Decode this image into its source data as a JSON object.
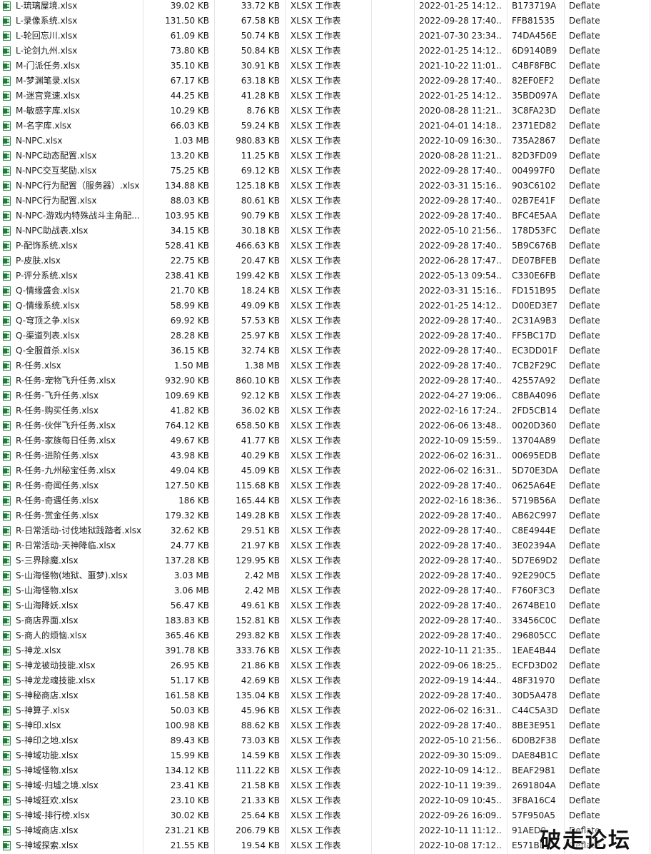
{
  "file_type_label": "XLSX 工作表",
  "method_label": "Deflate",
  "watermark": "破走论坛",
  "icon": "xlsx-file-icon",
  "files": [
    {
      "name": "L-琉璃屋境.xlsx",
      "size": "39.02 KB",
      "packed": "33.72 KB",
      "modified": "2022-01-25 14:12...",
      "crc": "B173719A"
    },
    {
      "name": "L-录像系统.xlsx",
      "size": "131.50 KB",
      "packed": "67.58 KB",
      "modified": "2022-09-28 17:40...",
      "crc": "FFB81535"
    },
    {
      "name": "L-轮回忘川.xlsx",
      "size": "61.09 KB",
      "packed": "50.74 KB",
      "modified": "2021-07-30 23:34...",
      "crc": "74DA456E"
    },
    {
      "name": "L-论剑九州.xlsx",
      "size": "73.80 KB",
      "packed": "50.84 KB",
      "modified": "2022-01-25 14:12...",
      "crc": "6D9140B9"
    },
    {
      "name": "M-门派任务.xlsx",
      "size": "35.10 KB",
      "packed": "30.91 KB",
      "modified": "2021-10-22 11:01...",
      "crc": "C4BF8FBC"
    },
    {
      "name": "M-梦渊笔录.xlsx",
      "size": "67.17 KB",
      "packed": "63.18 KB",
      "modified": "2022-09-28 17:40...",
      "crc": "82EF0EF2"
    },
    {
      "name": "M-迷宫竞速.xlsx",
      "size": "44.25 KB",
      "packed": "41.28 KB",
      "modified": "2022-01-25 14:12...",
      "crc": "35BD097A"
    },
    {
      "name": "M-敏感字库.xlsx",
      "size": "10.29 KB",
      "packed": "8.76 KB",
      "modified": "2020-08-28 11:21...",
      "crc": "3C8FA23D"
    },
    {
      "name": "M-名字库.xlsx",
      "size": "66.03 KB",
      "packed": "59.24 KB",
      "modified": "2021-04-01 14:18...",
      "crc": "2371ED82"
    },
    {
      "name": "N-NPC.xlsx",
      "size": "1.03 MB",
      "packed": "980.83 KB",
      "modified": "2022-10-09 16:30...",
      "crc": "735A2867"
    },
    {
      "name": "N-NPC动态配置.xlsx",
      "size": "13.20 KB",
      "packed": "11.25 KB",
      "modified": "2020-08-28 11:21...",
      "crc": "82D3FD09"
    },
    {
      "name": "N-NPC交互奖励.xlsx",
      "size": "75.25 KB",
      "packed": "69.12 KB",
      "modified": "2022-09-28 17:40...",
      "crc": "004997F0"
    },
    {
      "name": "N-NPC行为配置（服务器）.xlsx",
      "size": "134.88 KB",
      "packed": "125.18 KB",
      "modified": "2022-03-31 15:16...",
      "crc": "903C6102"
    },
    {
      "name": "N-NPC行为配置.xlsx",
      "size": "88.03 KB",
      "packed": "80.61 KB",
      "modified": "2022-09-28 17:40...",
      "crc": "02B7E41F"
    },
    {
      "name": "N-NPC-游戏内特殊战斗主角配...",
      "size": "103.95 KB",
      "packed": "90.79 KB",
      "modified": "2022-09-28 17:40...",
      "crc": "BFC4E5AA"
    },
    {
      "name": "N-NPC助战表.xlsx",
      "size": "34.15 KB",
      "packed": "30.18 KB",
      "modified": "2022-05-10 21:56...",
      "crc": "178D53FC"
    },
    {
      "name": "P-配饰系统.xlsx",
      "size": "528.41 KB",
      "packed": "466.63 KB",
      "modified": "2022-09-28 17:40...",
      "crc": "5B9C676B"
    },
    {
      "name": "P-皮肤.xlsx",
      "size": "22.75 KB",
      "packed": "20.47 KB",
      "modified": "2022-06-28 17:47...",
      "crc": "DE07BFEB"
    },
    {
      "name": "P-评分系统.xlsx",
      "size": "238.41 KB",
      "packed": "199.42 KB",
      "modified": "2022-05-13 09:54...",
      "crc": "C330E6FB"
    },
    {
      "name": "Q-情缘盛会.xlsx",
      "size": "21.70 KB",
      "packed": "18.24 KB",
      "modified": "2022-03-31 15:16...",
      "crc": "FD151B95"
    },
    {
      "name": "Q-情缘系统.xlsx",
      "size": "58.99 KB",
      "packed": "49.09 KB",
      "modified": "2022-01-25 14:12...",
      "crc": "D00ED3E7"
    },
    {
      "name": "Q-穹顶之争.xlsx",
      "size": "69.92 KB",
      "packed": "57.53 KB",
      "modified": "2022-09-28 17:40...",
      "crc": "2C31A9B3"
    },
    {
      "name": "Q-渠道列表.xlsx",
      "size": "28.28 KB",
      "packed": "25.97 KB",
      "modified": "2022-09-28 17:40...",
      "crc": "FF5BC17D"
    },
    {
      "name": "Q-全服首杀.xlsx",
      "size": "36.15 KB",
      "packed": "32.74 KB",
      "modified": "2022-09-28 17:40...",
      "crc": "EC3DD01F"
    },
    {
      "name": "R-任务.xlsx",
      "size": "1.50 MB",
      "packed": "1.38 MB",
      "modified": "2022-09-28 17:40...",
      "crc": "7CB2F29C"
    },
    {
      "name": "R-任务-宠物飞升任务.xlsx",
      "size": "932.90 KB",
      "packed": "860.10 KB",
      "modified": "2022-09-28 17:40...",
      "crc": "42557A92"
    },
    {
      "name": "R-任务-飞升任务.xlsx",
      "size": "109.69 KB",
      "packed": "92.12 KB",
      "modified": "2022-04-27 19:06...",
      "crc": "C8BA4096"
    },
    {
      "name": "R-任务-购买任务.xlsx",
      "size": "41.82 KB",
      "packed": "36.02 KB",
      "modified": "2022-02-16 17:24...",
      "crc": "2FD5CB14"
    },
    {
      "name": "R-任务-伙伴飞升任务.xlsx",
      "size": "764.12 KB",
      "packed": "658.50 KB",
      "modified": "2022-06-06 13:48...",
      "crc": "0020D360"
    },
    {
      "name": "R-任务-家族每日任务.xlsx",
      "size": "49.67 KB",
      "packed": "41.77 KB",
      "modified": "2022-10-09 15:59...",
      "crc": "13704A89"
    },
    {
      "name": "R-任务-进阶任务.xlsx",
      "size": "43.98 KB",
      "packed": "40.29 KB",
      "modified": "2022-06-02 16:31...",
      "crc": "00695EDB"
    },
    {
      "name": "R-任务-九州秘宝任务.xlsx",
      "size": "49.04 KB",
      "packed": "45.09 KB",
      "modified": "2022-06-02 16:31...",
      "crc": "5D70E3DA"
    },
    {
      "name": "R-任务-奇闻任务.xlsx",
      "size": "127.50 KB",
      "packed": "115.68 KB",
      "modified": "2022-09-28 17:40...",
      "crc": "0625A64E"
    },
    {
      "name": "R-任务-奇遇任务.xlsx",
      "size": "186 KB",
      "packed": "165.44 KB",
      "modified": "2022-02-16 18:36...",
      "crc": "5719B56A"
    },
    {
      "name": "R-任务-赏金任务.xlsx",
      "size": "179.32 KB",
      "packed": "149.28 KB",
      "modified": "2022-09-28 17:40...",
      "crc": "AB62C997"
    },
    {
      "name": "R-日常活动-讨伐地狱践踏者.xlsx",
      "size": "32.62 KB",
      "packed": "29.51 KB",
      "modified": "2022-09-28 17:40...",
      "crc": "C8E4944E"
    },
    {
      "name": "R-日常活动-天神降临.xlsx",
      "size": "24.77 KB",
      "packed": "21.97 KB",
      "modified": "2022-09-28 17:40...",
      "crc": "3E02394A"
    },
    {
      "name": "S-三界除魔.xlsx",
      "size": "137.28 KB",
      "packed": "129.95 KB",
      "modified": "2022-09-28 17:40...",
      "crc": "5D7E69D2"
    },
    {
      "name": "S-山海怪物(地狱、噩梦).xlsx",
      "size": "3.03 MB",
      "packed": "2.42 MB",
      "modified": "2022-09-28 17:40...",
      "crc": "92E290C5"
    },
    {
      "name": "S-山海怪物.xlsx",
      "size": "3.06 MB",
      "packed": "2.42 MB",
      "modified": "2022-09-28 17:40...",
      "crc": "F760F3C3"
    },
    {
      "name": "S-山海降妖.xlsx",
      "size": "56.47 KB",
      "packed": "49.61 KB",
      "modified": "2022-09-28 17:40...",
      "crc": "2674BE10"
    },
    {
      "name": "S-商店界面.xlsx",
      "size": "183.83 KB",
      "packed": "152.81 KB",
      "modified": "2022-09-28 17:40...",
      "crc": "33456C0C"
    },
    {
      "name": "S-商人的烦恼.xlsx",
      "size": "365.46 KB",
      "packed": "293.82 KB",
      "modified": "2022-09-28 17:40...",
      "crc": "296805CC"
    },
    {
      "name": "S-神龙.xlsx",
      "size": "391.78 KB",
      "packed": "333.76 KB",
      "modified": "2022-10-11 21:35...",
      "crc": "1EAE4B44"
    },
    {
      "name": "S-神龙被动技能.xlsx",
      "size": "26.95 KB",
      "packed": "21.86 KB",
      "modified": "2022-09-06 18:25...",
      "crc": "ECFD3D02"
    },
    {
      "name": "S-神龙龙魂技能.xlsx",
      "size": "51.17 KB",
      "packed": "42.69 KB",
      "modified": "2022-09-19 14:44...",
      "crc": "48F31970"
    },
    {
      "name": "S-神秘商店.xlsx",
      "size": "161.58 KB",
      "packed": "135.04 KB",
      "modified": "2022-09-28 17:40...",
      "crc": "30D5A478"
    },
    {
      "name": "S-神算子.xlsx",
      "size": "50.03 KB",
      "packed": "45.96 KB",
      "modified": "2022-06-02 16:31...",
      "crc": "C44C5A3D"
    },
    {
      "name": "S-神印.xlsx",
      "size": "100.98 KB",
      "packed": "88.62 KB",
      "modified": "2022-09-28 17:40...",
      "crc": "8BE3E951"
    },
    {
      "name": "S-神印之地.xlsx",
      "size": "89.43 KB",
      "packed": "73.03 KB",
      "modified": "2022-05-10 21:56...",
      "crc": "6D0B2F38"
    },
    {
      "name": "S-神域功能.xlsx",
      "size": "15.99 KB",
      "packed": "14.59 KB",
      "modified": "2022-09-30 15:09...",
      "crc": "DAE84B1C"
    },
    {
      "name": "S-神域怪物.xlsx",
      "size": "134.12 KB",
      "packed": "111.22 KB",
      "modified": "2022-10-09 14:12...",
      "crc": "BEAF2981"
    },
    {
      "name": "S-神域-归墟之境.xlsx",
      "size": "23.41 KB",
      "packed": "21.58 KB",
      "modified": "2022-10-11 19:39...",
      "crc": "2691804A"
    },
    {
      "name": "S-神域狂欢.xlsx",
      "size": "23.10 KB",
      "packed": "21.33 KB",
      "modified": "2022-10-09 10:45...",
      "crc": "3F8A16C4"
    },
    {
      "name": "S-神域-排行榜.xlsx",
      "size": "30.02 KB",
      "packed": "25.64 KB",
      "modified": "2022-09-26 16:09...",
      "crc": "57F950A5"
    },
    {
      "name": "S-神域商店.xlsx",
      "size": "231.21 KB",
      "packed": "206.79 KB",
      "modified": "2022-10-11 11:12...",
      "crc": "91AED0..."
    },
    {
      "name": "S-神域探索.xlsx",
      "size": "21.55 KB",
      "packed": "19.54 KB",
      "modified": "2022-10-08 17:12...",
      "crc": "E571BE..."
    }
  ]
}
